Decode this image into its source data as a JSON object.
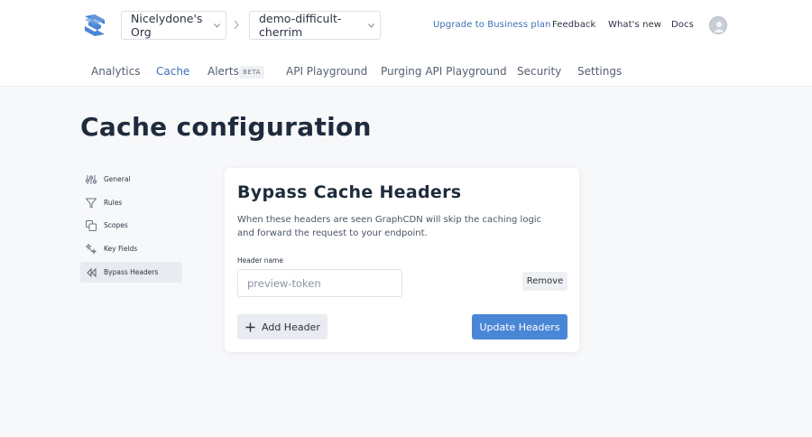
{
  "header": {
    "logo_icon": "graphcdn-logo-icon",
    "org": "Nicelydone's Org",
    "project": "demo-difficult-cherrim",
    "links": {
      "upgrade": "Upgrade to Business plan",
      "feedback": "Feedback",
      "whats_new": "What's new",
      "docs": "Docs"
    },
    "avatar_icon": "user-avatar-icon",
    "accent_color": "#3c6fb5"
  },
  "tabs": [
    {
      "label": "Analytics"
    },
    {
      "label": "Cache",
      "active": true
    },
    {
      "label": "Alerts",
      "badge": "BETA"
    },
    {
      "label": "API Playground"
    },
    {
      "label": "Purging API Playground"
    },
    {
      "label": "Security"
    },
    {
      "label": "Settings"
    }
  ],
  "page_title": "Cache configuration",
  "sidebar": {
    "items": [
      {
        "label": "General",
        "icon": "sliders-icon"
      },
      {
        "label": "Rules",
        "icon": "filter-icon"
      },
      {
        "label": "Scopes",
        "icon": "copy-icon"
      },
      {
        "label": "Key Fields",
        "icon": "key-fields-icon"
      },
      {
        "label": "Bypass Headers",
        "icon": "bypass-headers-icon",
        "active": true
      }
    ]
  },
  "card": {
    "title": "Bypass Cache Headers",
    "description": "When these headers are seen GraphCDN will skip the caching logic and forward the request to your endpoint.",
    "field_label": "Header name",
    "field_value": "",
    "field_placeholder": "preview-token",
    "remove_label": "Remove",
    "add_label": "Add Header",
    "update_label": "Update Headers",
    "primary_color": "#4a86d6"
  }
}
